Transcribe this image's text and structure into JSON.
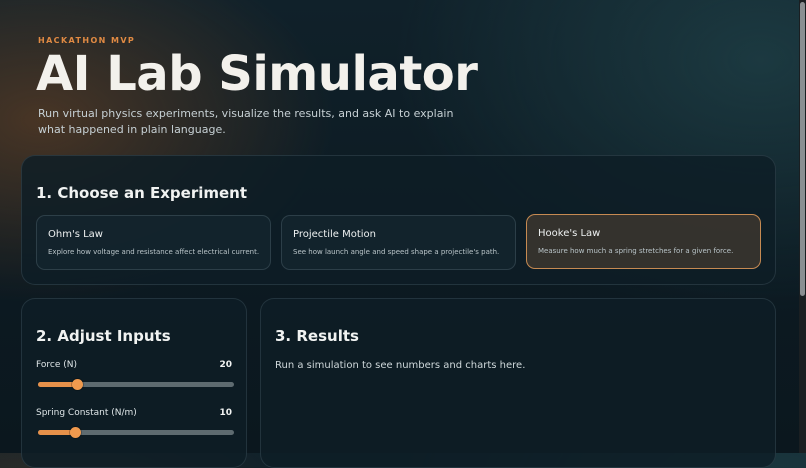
{
  "header": {
    "eyebrow": "HACKATHON MVP",
    "title": "AI Lab Simulator",
    "subtitle": "Run virtual physics experiments, visualize the results, and ask AI to explain what happened in plain language."
  },
  "experiments": {
    "heading": "1. Choose an Experiment",
    "selected": "Hooke's Law",
    "cards": [
      {
        "title": "Ohm's Law",
        "description": "Explore how voltage and resistance affect electrical current."
      },
      {
        "title": "Projectile Motion",
        "description": "See how launch angle and speed shape a projectile's path."
      },
      {
        "title": "Hooke's Law",
        "description": "Measure how much a spring stretches for a given force."
      }
    ]
  },
  "inputs": {
    "heading": "2. Adjust Inputs",
    "sliders": [
      {
        "label": "Force (N)",
        "value": "20",
        "fraction": 0.2
      },
      {
        "label": "Spring Constant (N/m)",
        "value": "10",
        "fraction": 0.19
      }
    ]
  },
  "results": {
    "heading": "3. Results",
    "message": "Run a simulation to see numbers and charts here."
  },
  "colors": {
    "accent": "#e6914a",
    "eyebrow": "#e08a43",
    "selected_border": "#c68a52"
  }
}
